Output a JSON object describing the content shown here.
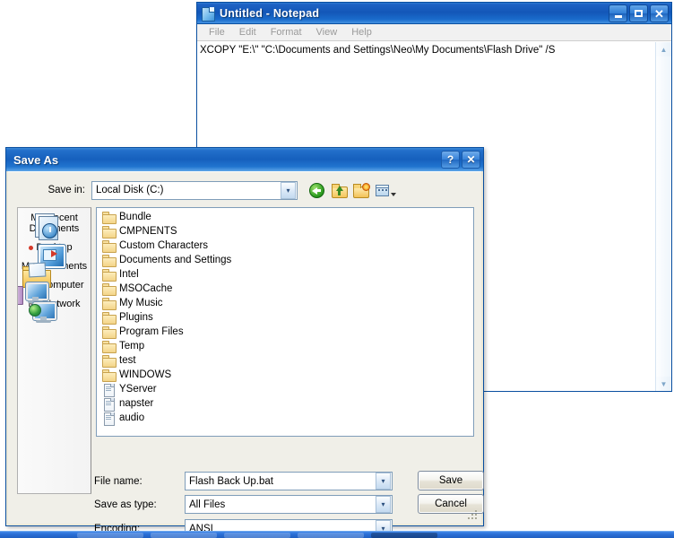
{
  "notepad": {
    "title": "Untitled - Notepad",
    "icon": "notepad-icon",
    "menu": [
      "File",
      "Edit",
      "Format",
      "View",
      "Help"
    ],
    "content": "XCOPY \"E:\\\" \"C:\\Documents and Settings\\Neo\\My Documents\\Flash Drive\" /S",
    "window_buttons": {
      "minimize": "minimize-button",
      "maximize": "maximize-button",
      "close": "close-button"
    },
    "scrollbar": {
      "up": "▲",
      "down": "▼"
    }
  },
  "save_dialog": {
    "title": "Save As",
    "help_label": "?",
    "close_label": "✕",
    "save_in_label": "Save in:",
    "save_in_value": "Local Disk (C:)",
    "toolbar": [
      {
        "name": "back-icon",
        "tooltip": "Back"
      },
      {
        "name": "up-one-level-icon",
        "tooltip": "Up One Level"
      },
      {
        "name": "create-new-folder-icon",
        "tooltip": "Create New Folder"
      },
      {
        "name": "views-icon",
        "tooltip": "Views"
      }
    ],
    "places": [
      {
        "label": "My Recent Documents",
        "icon": "recent-documents-icon"
      },
      {
        "label": "Desktop",
        "icon": "desktop-icon"
      },
      {
        "label": "My Documents",
        "icon": "my-documents-icon"
      },
      {
        "label": "My Computer",
        "icon": "my-computer-icon"
      },
      {
        "label": "My Network",
        "icon": "my-network-icon"
      }
    ],
    "files": [
      {
        "name": "Bundle",
        "type": "folder"
      },
      {
        "name": "CMPNENTS",
        "type": "folder"
      },
      {
        "name": "Custom Characters",
        "type": "folder"
      },
      {
        "name": "Documents and Settings",
        "type": "folder"
      },
      {
        "name": "Intel",
        "type": "folder"
      },
      {
        "name": "MSOCache",
        "type": "folder"
      },
      {
        "name": "My Music",
        "type": "folder"
      },
      {
        "name": "Plugins",
        "type": "folder"
      },
      {
        "name": "Program Files",
        "type": "folder"
      },
      {
        "name": "Temp",
        "type": "folder"
      },
      {
        "name": "test",
        "type": "folder"
      },
      {
        "name": "WINDOWS",
        "type": "folder"
      },
      {
        "name": "YServer",
        "type": "file"
      },
      {
        "name": "napster",
        "type": "file"
      },
      {
        "name": "audio",
        "type": "file"
      }
    ],
    "file_name_label": "File name:",
    "file_name_value": "Flash Back Up.bat",
    "save_as_type_label": "Save as type:",
    "save_as_type_value": "All Files",
    "encoding_label": "Encoding:",
    "encoding_value": "ANSI",
    "save_button": "Save",
    "cancel_button": "Cancel",
    "dropdown_arrow": "⌵"
  },
  "colors": {
    "titlebar_blue": "#1660bd",
    "dialog_face": "#f0efe8",
    "desktop": "#ffffff",
    "folder_yellow": "#f3d488"
  }
}
